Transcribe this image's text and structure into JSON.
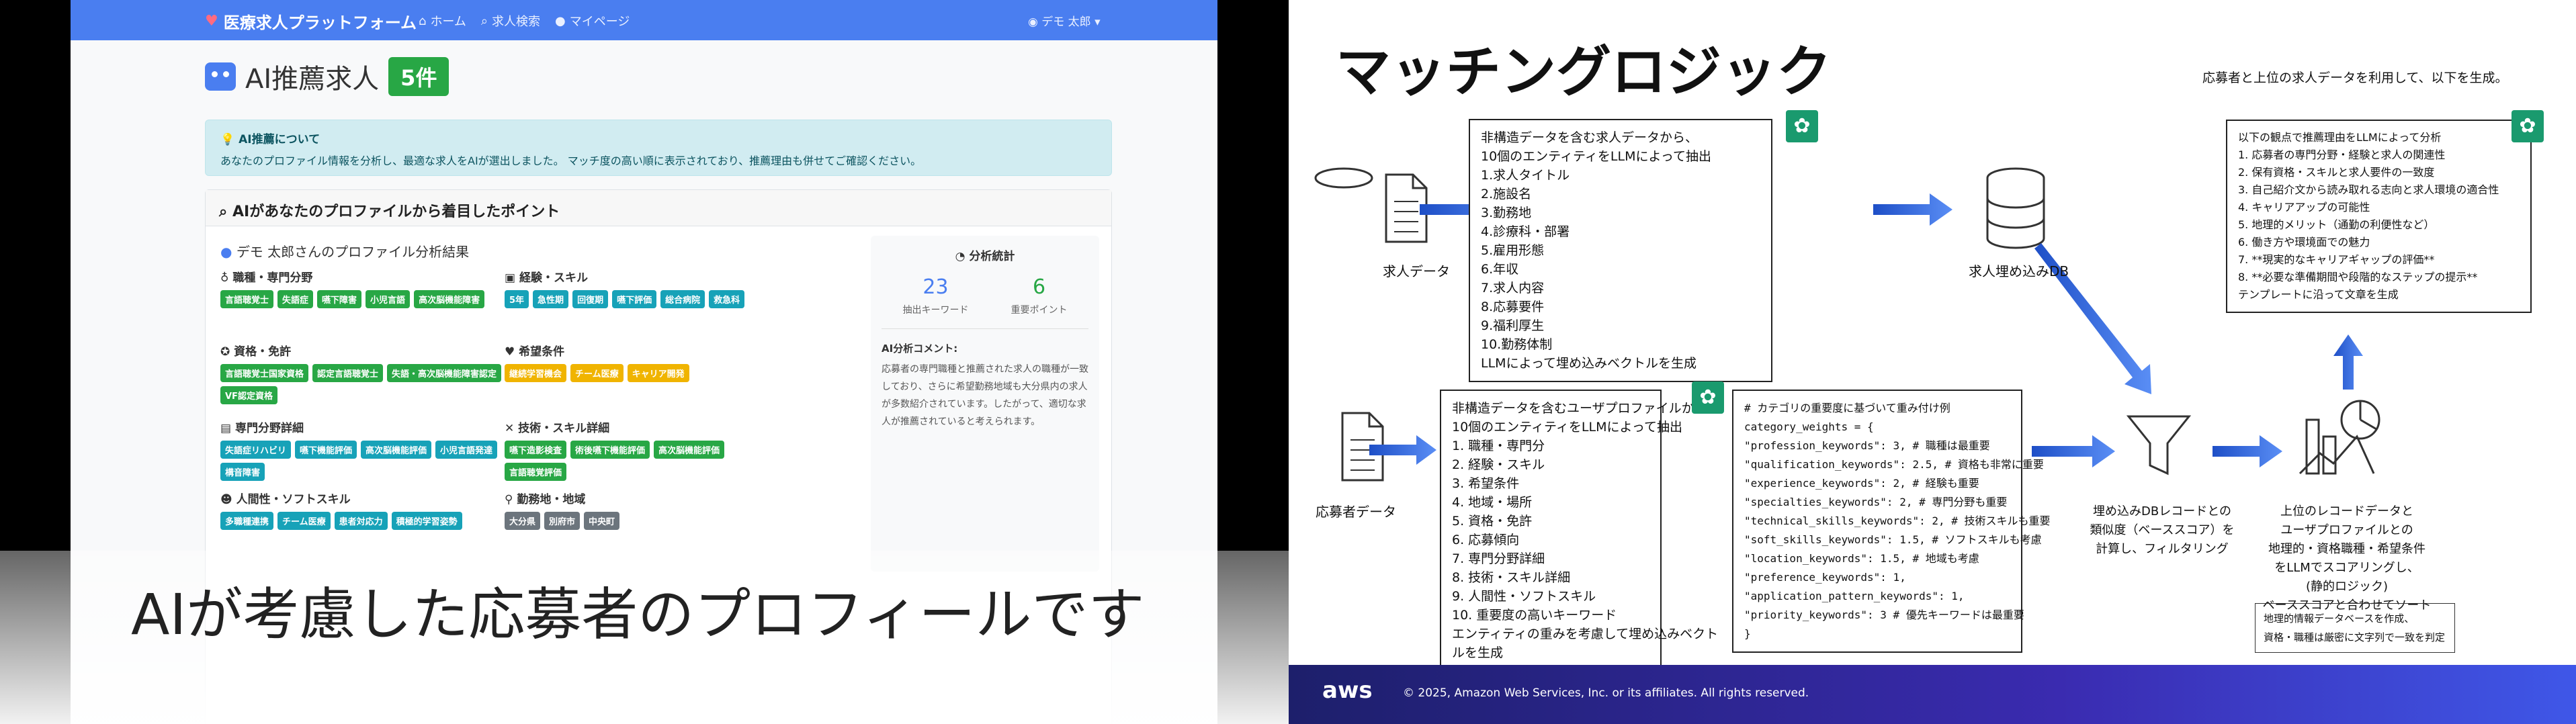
{
  "left": {
    "navbar": {
      "brand": "医療求人プラットフォーム",
      "links": [
        "ホーム",
        "求人検索",
        "マイページ"
      ],
      "user": "デモ 太郎"
    },
    "header": {
      "title": "AI推薦求人",
      "count": "5件"
    },
    "alert": {
      "title": "AI推薦について",
      "body": "あなたのプロファイル情報を分析し、最適な求人をAIが選出しました。 マッチ度の高い順に表示されており、推薦理由も併せてご確認ください。"
    },
    "card": {
      "title": "AIがあなたのプロファイルから着目したポイント",
      "profile_title": "デモ 太郎さんのプロファイル分析結果",
      "sections": [
        {
          "title": "職種・専門分野",
          "tags": [
            "言語聴覚士",
            "失語症",
            "嚥下障害",
            "小児言語",
            "高次脳機能障害"
          ]
        },
        {
          "title": "経験・スキル",
          "tags": [
            "5年",
            "急性期",
            "回復期",
            "嚥下評価",
            "総合病院",
            "救急科"
          ]
        },
        {
          "title": "資格・免許",
          "tags": [
            "言語聴覚士国家資格",
            "認定言語聴覚士",
            "失語・高次脳機能障害認定",
            "VF認定資格"
          ]
        },
        {
          "title": "希望条件",
          "tags": [
            "継続学習機会",
            "チーム医療",
            "キャリア開発"
          ]
        },
        {
          "title": "専門分野詳細",
          "tags": [
            "失語症リハビリ",
            "嚥下機能評価",
            "高次脳機能評価",
            "小児言語発達",
            "構音障害"
          ]
        },
        {
          "title": "技術・スキル詳細",
          "tags": [
            "嚥下造影検査",
            "術後嚥下機能評価",
            "高次脳機能評価",
            "言語聴覚評価"
          ]
        },
        {
          "title": "人間性・ソフトスキル",
          "tags": [
            "多職種連携",
            "チーム医療",
            "患者対応力",
            "積極的学習姿勢"
          ]
        },
        {
          "title": "勤務地・地域",
          "tags": [
            "大分県",
            "別府市",
            "中央町"
          ]
        }
      ],
      "stats": {
        "title": "分析統計",
        "keywords": "23",
        "keywords_label": "抽出キーワード",
        "points": "6",
        "points_label": "重要ポイント",
        "comment_title": "AI分析コメント:",
        "comment": "応募者の専門職種と推薦された求人の職種が一致しており、さらに希望勤務地域も大分県内の求人が多数紹介されています。したがって、適切な求人が推薦されていると考えられます。"
      }
    },
    "caption": "AIが考慮した応募者のプロフィールです"
  },
  "slide": {
    "title": "マッチングロジック",
    "job_label": "求人データ",
    "applicant_label": "応募者データ",
    "db_label": "求人埋め込みDB",
    "top_text": "応募者と上位の求人データを利用して、以下を生成。",
    "job_box": [
      "非構造データを含む求人データから、",
      "10個のエンティティをLLMによって抽出",
      "1.求人タイトル",
      "2.施設名",
      "3.勤務地",
      "4.診療科・部署",
      "5.雇用形態",
      "6.年収",
      "7.求人内容",
      "8.応募要件",
      "9.福利厚生",
      "10.勤務体制",
      "LLMによって埋め込みベクトルを生成"
    ],
    "applicant_box": [
      "非構造データを含むユーザプロファイルから",
      "10個のエンティティをLLMによって抽出",
      "1. 職種・専門分",
      "2. 経験・スキル",
      "3. 希望条件",
      "4. 地域・場所",
      "5. 資格・免許",
      "6. 応募傾向",
      "7. 専門分野詳細",
      "8. 技術・スキル詳細",
      "9. 人間性・ソフトスキル",
      "10. 重要度の高いキーワード",
      "エンティティの重みを考慮して埋め込みベクト",
      "ルを生成"
    ],
    "code_box": [
      "# カテゴリの重要度に基づいて重み付け例",
      "category_weights = {",
      "\"profession_keywords\": 3, # 職種は最重要",
      "\"qualification_keywords\": 2.5, # 資格も非常に重要",
      "\"experience_keywords\": 2, # 経験も重要",
      "\"specialties_keywords\": 2, # 専門分野も重要",
      "\"technical_skills_keywords\": 2, # 技術スキルも重要",
      "\"soft_skills_keywords\": 1.5, # ソフトスキルも考慮",
      "\"location_keywords\": 1.5, # 地域も考慮",
      "\"preference_keywords\": 1,",
      "\"application_pattern_keywords\": 1,",
      "\"priority_keywords\": 3 # 優先キーワードは最重要",
      "}"
    ],
    "reason_box": [
      "以下の観点で推薦理由をLLMによって分析",
      "1. 応募者の専門分野・経験と求人の関連性",
      "2. 保有資格・スキルと求人要件の一致度",
      "3. 自己紹介文から読み取れる志向と求人環境の適合性",
      "4. キャリアアップの可能性",
      "5. 地理的メリット（通勤の利便性など）",
      "6. 働き方や環境面での魅力",
      "7. **現実的なキャリアギャップの評価**",
      "8. **必要な準備期間や段階的なステップの提示**",
      "テンプレートに沿って文章を生成"
    ],
    "filter_label": [
      "埋め込みDBレコードとの",
      "類似度（ベーススコア）を",
      "計算し、フィルタリング"
    ],
    "score_label": [
      "上位のレコードデータと",
      "ユーザプロファイルとの",
      "地理的・資格職種・希望条件",
      "をLLMでスコアリングし、",
      "(静的ロジック)",
      "ベーススコアと合わせてソート"
    ],
    "note": [
      "地理的情報データベースを作成、",
      "資格・職種は厳密に文字列で一致を判定"
    ],
    "footer": {
      "logo": "aws",
      "copyright": "© 2025, Amazon Web Services, Inc. or its affiliates. All rights reserved."
    },
    "colors": {
      "arrow": "#2d6be0",
      "footer_start": "#1d1f6b",
      "footer_end": "#3f57e8",
      "gpt": "#1a9a6e"
    }
  }
}
